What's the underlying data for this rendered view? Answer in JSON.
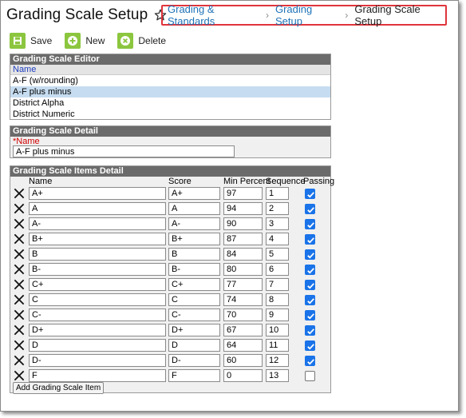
{
  "header": {
    "title": "Grading Scale Setup",
    "star_icon": "star-outline-icon",
    "breadcrumb": [
      "Grading & Standards",
      "Grading Setup",
      "Grading Scale Setup"
    ]
  },
  "toolbar": {
    "save_label": "Save",
    "new_label": "New",
    "delete_label": "Delete",
    "accent_color": "#8cc63f"
  },
  "editor": {
    "header": "Grading Scale Editor",
    "column": "Name",
    "rows": [
      "A-F (w/rounding)",
      "A-F plus minus",
      "District Alpha",
      "District Numeric"
    ],
    "selected": "A-F plus minus"
  },
  "detail": {
    "header": "Grading Scale Detail",
    "name_label": "*Name",
    "name_value": "A-F plus minus"
  },
  "items": {
    "header": "Grading Scale Items Detail",
    "columns": {
      "name": "Name",
      "score": "Score",
      "min_percent": "Min Percent",
      "sequence": "Sequence",
      "passing": "Passing"
    },
    "rows": [
      {
        "name": "A+",
        "score": "A+",
        "min": "97",
        "seq": "1",
        "passing": true
      },
      {
        "name": "A",
        "score": "A",
        "min": "94",
        "seq": "2",
        "passing": true
      },
      {
        "name": "A-",
        "score": "A-",
        "min": "90",
        "seq": "3",
        "passing": true
      },
      {
        "name": "B+",
        "score": "B+",
        "min": "87",
        "seq": "4",
        "passing": true
      },
      {
        "name": "B",
        "score": "B",
        "min": "84",
        "seq": "5",
        "passing": true
      },
      {
        "name": "B-",
        "score": "B-",
        "min": "80",
        "seq": "6",
        "passing": true
      },
      {
        "name": "C+",
        "score": "C+",
        "min": "77",
        "seq": "7",
        "passing": true
      },
      {
        "name": "C",
        "score": "C",
        "min": "74",
        "seq": "8",
        "passing": true
      },
      {
        "name": "C-",
        "score": "C-",
        "min": "70",
        "seq": "9",
        "passing": true
      },
      {
        "name": "D+",
        "score": "D+",
        "min": "67",
        "seq": "10",
        "passing": true
      },
      {
        "name": "D",
        "score": "D",
        "min": "64",
        "seq": "11",
        "passing": true
      },
      {
        "name": "D-",
        "score": "D-",
        "min": "60",
        "seq": "12",
        "passing": true
      },
      {
        "name": "F",
        "score": "F",
        "min": "0",
        "seq": "13",
        "passing": false
      }
    ],
    "add_label": "Add Grading Scale Item"
  }
}
